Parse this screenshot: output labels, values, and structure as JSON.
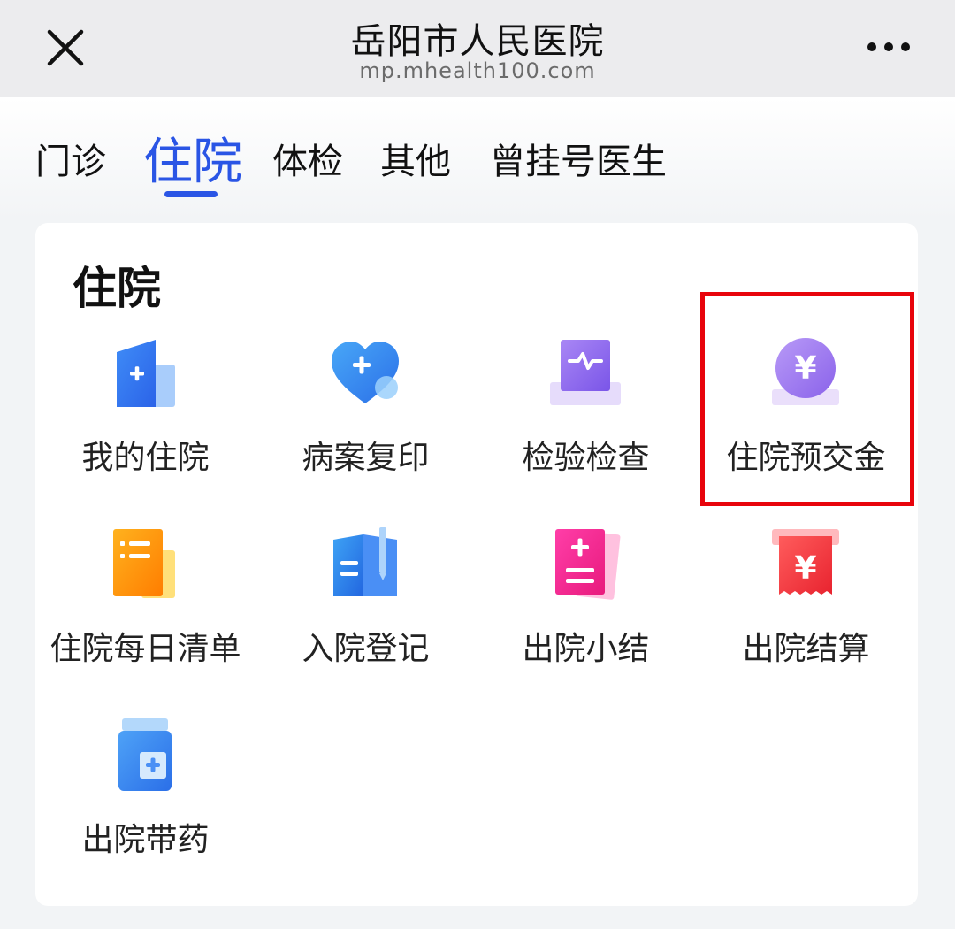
{
  "header": {
    "title": "岳阳市人民医院",
    "url": "mp.mhealth100.com"
  },
  "tabs": [
    {
      "label": "门诊"
    },
    {
      "label": "住院"
    },
    {
      "label": "体检"
    },
    {
      "label": "其他"
    },
    {
      "label": "曾挂号医生"
    }
  ],
  "active_tab": "住院",
  "section": {
    "title": "住院",
    "items": [
      {
        "label": "我的住院",
        "icon": "hospital-building-icon"
      },
      {
        "label": "病案复印",
        "icon": "heart-plus-icon"
      },
      {
        "label": "检验检查",
        "icon": "monitor-pulse-icon"
      },
      {
        "label": "住院预交金",
        "icon": "yen-coin-icon"
      },
      {
        "label": "住院每日清单",
        "icon": "daily-list-icon"
      },
      {
        "label": "入院登记",
        "icon": "book-pen-icon"
      },
      {
        "label": "出院小结",
        "icon": "summary-document-icon"
      },
      {
        "label": "出院结算",
        "icon": "yen-receipt-icon"
      },
      {
        "label": "出院带药",
        "icon": "medicine-bottle-icon"
      }
    ]
  },
  "colors": {
    "accent": "#2a55e5",
    "highlight": "#e8040c"
  }
}
